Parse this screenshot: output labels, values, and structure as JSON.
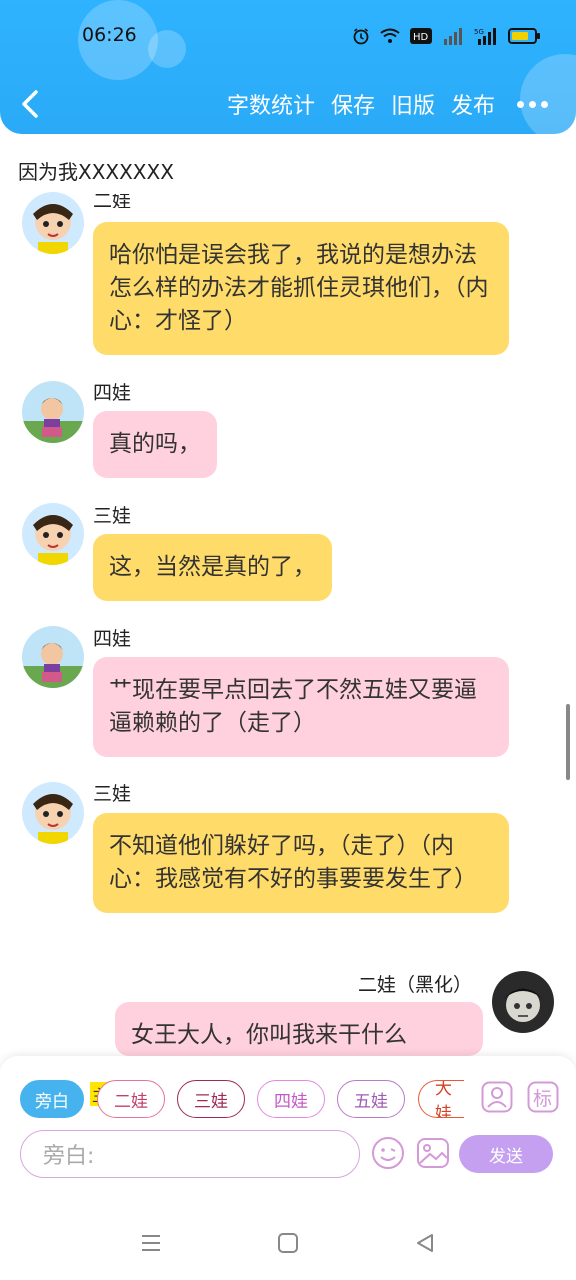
{
  "status_bar": {
    "time": "06:26"
  },
  "header": {
    "toolbar": [
      "字数统计",
      "保存",
      "旧版",
      "发布"
    ]
  },
  "doc_title": "因为我XXXXXXX",
  "messages": [
    {
      "speaker": "二娃",
      "text": "哈你怕是误会我了，我说的是想办法怎么样的办法才能抓住灵琪他们，（内心：才怪了）",
      "color": "yellow"
    },
    {
      "speaker": "四娃",
      "text": "真的吗，",
      "color": "pink"
    },
    {
      "speaker": "三娃",
      "text": "这，当然是真的了，",
      "color": "yellow"
    },
    {
      "speaker": "四娃",
      "text": "艹现在要早点回去了不然五娃又要逼逼赖赖的了（走了）",
      "color": "pink"
    },
    {
      "speaker": "三娃",
      "text": "不知道他们躲好了吗，（走了）（内心：我感觉有不好的事要要发生了）",
      "color": "yellow"
    },
    {
      "speaker": "二娃（黑化）",
      "text": "女王大人，你叫我来干什么",
      "color": "pink"
    }
  ],
  "composer": {
    "chips": [
      "旁白",
      "二娃",
      "三娃",
      "四娃",
      "五娃",
      "大娃"
    ],
    "main_badge": "主",
    "tag_label": "标",
    "input_placeholder": "旁白:",
    "send_label": "发送"
  },
  "colors": {
    "header": "#2aaaf7",
    "yellow_bubble": "#ffdc6a",
    "pink_bubble": "#ffd0dd",
    "send": "#c59ff0",
    "chip_active": "#46b3ef"
  }
}
